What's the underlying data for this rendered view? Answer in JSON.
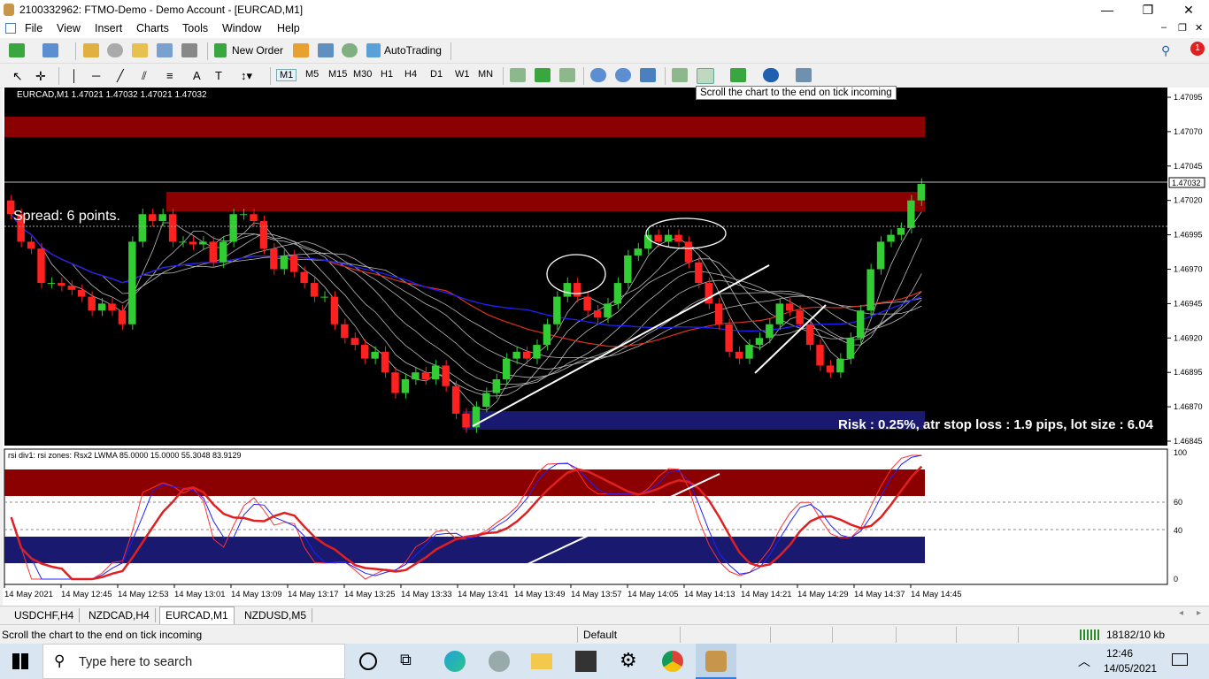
{
  "window": {
    "title": "2100332962: FTMO-Demo - Demo Account - [EURCAD,M1]",
    "minimize": "—",
    "maximize": "❐",
    "close": "✕"
  },
  "menu": [
    "File",
    "View",
    "Insert",
    "Charts",
    "Tools",
    "Window",
    "Help"
  ],
  "toolbar": {
    "new_order": "New Order",
    "autotrading": "AutoTrading"
  },
  "timeframes": [
    "M1",
    "M5",
    "M15",
    "M30",
    "H1",
    "H4",
    "D1",
    "W1",
    "MN"
  ],
  "tooltip": "Scroll the chart to the end on tick incoming",
  "chart": {
    "header": "EURCAD,M1  1.47021 1.47032 1.47021 1.47032",
    "spread": "Spread: 6 points.",
    "risk": "Risk : 0.25%, atr stop loss : 1.9 pips, lot size : 6.04",
    "current_price": "1.47032",
    "price_ticks": [
      "1.47095",
      "1.47070",
      "1.47045",
      "1.47020",
      "1.46995",
      "1.46970",
      "1.46945",
      "1.46920",
      "1.46895",
      "1.46870",
      "1.46845"
    ],
    "time_ticks": [
      "14 May 2021",
      "14 May 12:45",
      "14 May 12:53",
      "14 May 13:01",
      "14 May 13:09",
      "14 May 13:17",
      "14 May 13:25",
      "14 May 13:33",
      "14 May 13:41",
      "14 May 13:49",
      "14 May 13:57",
      "14 May 14:05",
      "14 May 14:13",
      "14 May 14:21",
      "14 May 14:29",
      "14 May 14:37",
      "14 May 14:45"
    ],
    "ind_header": "rsi div1: rsi zones: Rsx2 LWMA 85.0000 15.0000 55.3048 83.9129",
    "ind_ticks": [
      "100",
      "60",
      "40",
      "0"
    ]
  },
  "tabs": [
    "USDCHF,H4",
    "NZDCAD,H4",
    "EURCAD,M1",
    "NZDUSD,M5"
  ],
  "active_tab": 2,
  "status": {
    "hint": "Scroll the chart to the end on tick incoming",
    "profile": "Default",
    "traffic": "18182/10 kb"
  },
  "taskbar": {
    "search_placeholder": "Type here to search",
    "time": "12:46",
    "date": "14/05/2021"
  },
  "colors": {
    "bull": "#32cd32",
    "bear": "#ff2020",
    "zone_red": "#8b0000",
    "zone_blue": "#191970",
    "ma_blue": "#2020ff"
  },
  "chart_data": {
    "type": "candlestick",
    "symbol": "EURCAD,M1",
    "ylim": [
      1.46845,
      1.47095
    ],
    "closes": [
      1.4701,
      1.4699,
      1.46985,
      1.4696,
      1.4696,
      1.46958,
      1.46955,
      1.4695,
      1.4694,
      1.46945,
      1.4694,
      1.4693,
      1.4699,
      1.4701,
      1.47005,
      1.4701,
      1.4699,
      1.4699,
      1.46988,
      1.4699,
      1.46975,
      1.4699,
      1.4701,
      1.4701,
      1.47005,
      1.46985,
      1.4697,
      1.4698,
      1.46968,
      1.4696,
      1.4695,
      1.4695,
      1.4693,
      1.4692,
      1.46915,
      1.46905,
      1.4691,
      1.46895,
      1.4688,
      1.4689,
      1.46895,
      1.4689,
      1.469,
      1.46885,
      1.46865,
      1.46855,
      1.4687,
      1.4688,
      1.4689,
      1.46905,
      1.4691,
      1.46905,
      1.46915,
      1.4693,
      1.4695,
      1.4696,
      1.4695,
      1.4694,
      1.46935,
      1.46945,
      1.4696,
      1.4698,
      1.46985,
      1.46995,
      1.4699,
      1.46995,
      1.4699,
      1.46975,
      1.4696,
      1.46945,
      1.4693,
      1.4691,
      1.46905,
      1.46915,
      1.4692,
      1.4693,
      1.46945,
      1.4694,
      1.4693,
      1.46915,
      1.469,
      1.46895,
      1.46905,
      1.4692,
      1.4694,
      1.4697,
      1.4699,
      1.46995,
      1.47,
      1.4702,
      1.47032
    ]
  }
}
